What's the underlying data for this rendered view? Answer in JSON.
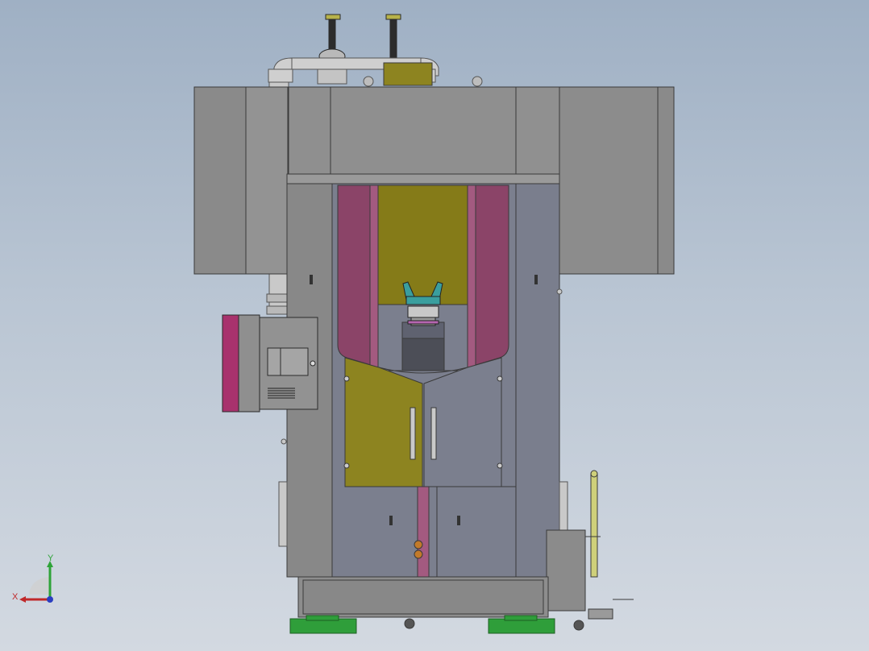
{
  "viewport": {
    "background_top": "#9fb0c4",
    "background_bottom": "#d3d9e1"
  },
  "machine": {
    "colors": {
      "housing": "#8a8a8a",
      "housing_light": "#969696",
      "panel_steel": "#7b7f8e",
      "magenta_liner": "#8b4468",
      "olive": "#857b18",
      "olive_door": "#8d8420",
      "teal_part": "#3a9e9e",
      "green_feet": "#2f9e3a",
      "control_box": "#8f8f8f",
      "control_box_side": "#a8326d",
      "pipe": "#c9c9c9",
      "outline": "#3a3a3a"
    }
  },
  "triad": {
    "x_label": "X",
    "y_label": "Y",
    "x_color": "#c0282a",
    "y_color": "#2ea338",
    "z_color": "#2a3ec0"
  }
}
